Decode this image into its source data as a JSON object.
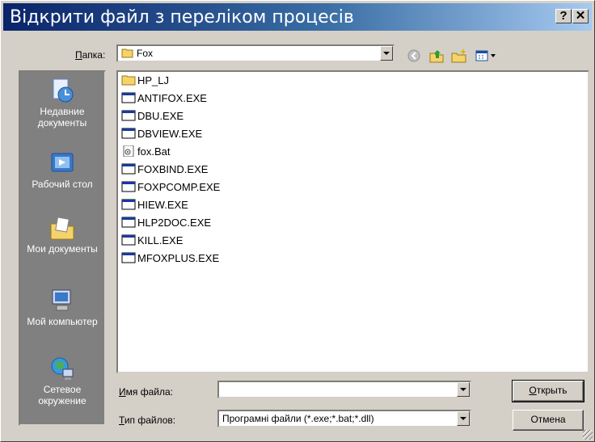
{
  "window": {
    "title": "Відкрити файл з переліком процесів",
    "help_label": "?",
    "close_label": "✕"
  },
  "folder": {
    "label": "Папка:",
    "label_access": "П",
    "label_rest": "апка:",
    "value": "Fox"
  },
  "places": [
    {
      "label": "Недавние документы",
      "icon": "recent-documents-icon"
    },
    {
      "label": "Рабочий стол",
      "icon": "desktop-icon"
    },
    {
      "label": "Мои документы",
      "icon": "my-documents-icon"
    },
    {
      "label": "Мой компьютер",
      "icon": "my-computer-icon"
    },
    {
      "label": "Сетевое окружение",
      "icon": "network-icon"
    }
  ],
  "files": [
    {
      "name": "HP_LJ",
      "type": "folder"
    },
    {
      "name": "ANTIFOX.EXE",
      "type": "exe"
    },
    {
      "name": "DBU.EXE",
      "type": "exe"
    },
    {
      "name": "DBVIEW.EXE",
      "type": "exe"
    },
    {
      "name": "fox.Bat",
      "type": "bat"
    },
    {
      "name": "FOXBIND.EXE",
      "type": "exe"
    },
    {
      "name": "FOXPCOMP.EXE",
      "type": "exe"
    },
    {
      "name": "HIEW.EXE",
      "type": "exe"
    },
    {
      "name": "HLP2DOC.EXE",
      "type": "exe"
    },
    {
      "name": "KILL.EXE",
      "type": "exe"
    },
    {
      "name": "MFOXPLUS.EXE",
      "type": "exe"
    }
  ],
  "filename": {
    "label_access": "И",
    "label_rest": "мя файла:",
    "value": ""
  },
  "filetype": {
    "label_access": "Т",
    "label_rest": "ип файлов:",
    "value": "Програмні файли (*.exe;*.bat;*.dll)"
  },
  "buttons": {
    "open_access": "О",
    "open_rest": "ткрыть",
    "cancel": "Отмена"
  },
  "colors": {
    "title_start": "#0a246a",
    "title_end": "#a6caf0",
    "face": "#d4d0c8",
    "places_bg": "#808080"
  }
}
